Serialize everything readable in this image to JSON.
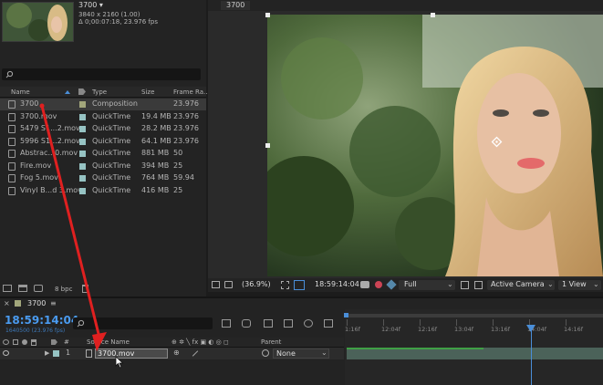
{
  "project": {
    "comp_name": "3700",
    "comp_dimensions": "3840 x 2160 (1.00)",
    "comp_duration": "Δ 0;00:07:18, 23.976 fps",
    "search_placeholder": "",
    "columns": {
      "name": "Name",
      "type": "Type",
      "size": "Size",
      "frame_rate": "Frame Ra..."
    },
    "items": [
      {
        "name": "3700",
        "type": "Composition",
        "size": "",
        "fps": "23.976",
        "label_color": "#a2a67b",
        "selected": true
      },
      {
        "name": "3700.mov",
        "type": "QuickTime",
        "size": "19.4 MB",
        "fps": "23.976",
        "label_color": "#96c3c3",
        "selected": false
      },
      {
        "name": "5479 S1...2.mov",
        "type": "QuickTime",
        "size": "28.2 MB",
        "fps": "23.976",
        "label_color": "#96c3c3",
        "selected": false
      },
      {
        "name": "5996 S1...2.mov",
        "type": "QuickTime",
        "size": "64.1 MB",
        "fps": "23.976",
        "label_color": "#96c3c3",
        "selected": false
      },
      {
        "name": "Abstrac...0.mov",
        "type": "QuickTime",
        "size": "881 MB",
        "fps": "50",
        "label_color": "#96c3c3",
        "selected": false
      },
      {
        "name": "Fire.mov",
        "type": "QuickTime",
        "size": "394 MB",
        "fps": "25",
        "label_color": "#96c3c3",
        "selected": false
      },
      {
        "name": "Fog 5.mov",
        "type": "QuickTime",
        "size": "764 MB",
        "fps": "59.94",
        "label_color": "#96c3c3",
        "selected": false
      },
      {
        "name": "Vinyl B...d 3.mov",
        "type": "QuickTime",
        "size": "416 MB",
        "fps": "25",
        "label_color": "#96c3c3",
        "selected": false
      }
    ],
    "bpc": "8 bpc"
  },
  "viewer": {
    "tab": "3700",
    "zoom": "(36.9%)",
    "timecode": "18:59:14:04",
    "resolution": "Full",
    "camera": "Active Camera",
    "view": "1 View"
  },
  "timeline": {
    "comp_tab": "3700",
    "current_time": "18:59:14:04",
    "frame_info": "1640500 (23.976 fps)",
    "columns": {
      "num": "#",
      "source_name": "Source Name",
      "parent": "Parent"
    },
    "layer": {
      "index": "1",
      "name": "3700.mov",
      "parent": "None"
    },
    "ruler_labels": [
      "1:16f",
      "12:04f",
      "12:16f",
      "13:04f",
      "13:16f",
      "14:04f",
      "14:16f"
    ]
  },
  "colors": {
    "accent_blue": "#4a8ed8",
    "arrow_red": "#e02020"
  }
}
